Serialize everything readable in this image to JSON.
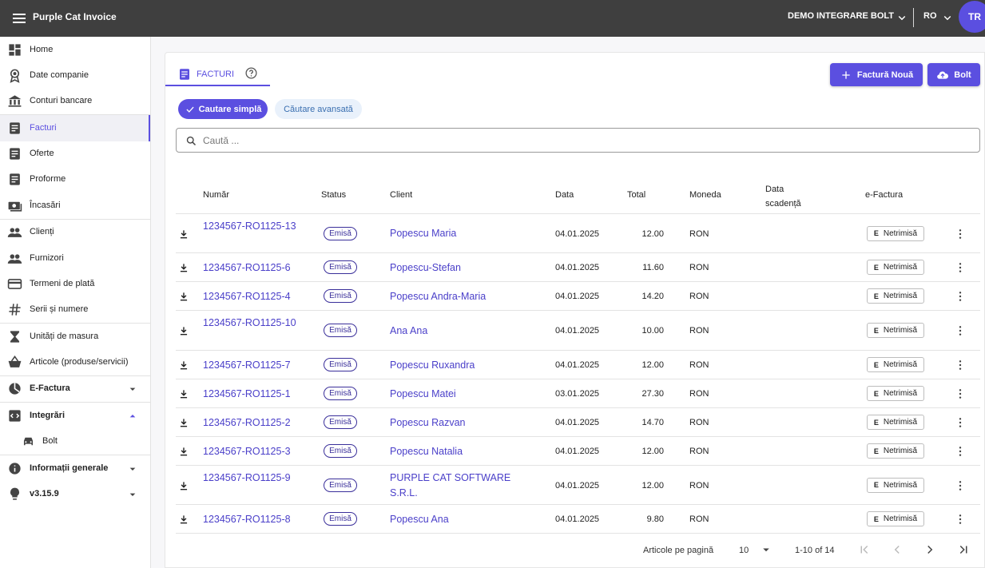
{
  "app": {
    "title": "Purple Cat Invoice",
    "account": "DEMO INTEGRARE BOLT",
    "language": "RO",
    "avatar_initials": "TR",
    "accent_color": "#5b4fe0",
    "topbar_color": "#3f3f3f"
  },
  "sidebar": {
    "items": [
      {
        "label": "Home",
        "icon": "dashboard-icon"
      },
      {
        "label": "Date companie",
        "icon": "badge-icon"
      },
      {
        "label": "Conturi bancare",
        "icon": "bank-icon"
      },
      {
        "label": "Facturi",
        "icon": "document-icon",
        "active": true
      },
      {
        "label": "Oferte",
        "icon": "document-icon"
      },
      {
        "label": "Proforme",
        "icon": "document-icon"
      },
      {
        "label": "Încasări",
        "icon": "payments-icon"
      },
      {
        "label": "Clienți",
        "icon": "people-icon"
      },
      {
        "label": "Furnizori",
        "icon": "people-icon"
      },
      {
        "label": "Termeni de plată",
        "icon": "credit-card-icon"
      },
      {
        "label": "Serii și numere",
        "icon": "hash-icon"
      },
      {
        "label": "Unități de masura",
        "icon": "hourglass-icon"
      },
      {
        "label": "Articole (produse/servicii)",
        "icon": "basket-icon"
      },
      {
        "label": "E-Factura",
        "icon": "pie-chart-icon"
      },
      {
        "label": "Integrări",
        "icon": "integration-icon"
      },
      {
        "label": "Bolt",
        "icon": "car-icon"
      },
      {
        "label": "Informații generale",
        "icon": "info-icon"
      },
      {
        "label": "v3.15.9",
        "icon": "lightbulb-icon"
      }
    ]
  },
  "main": {
    "tab_label": "FACTURI",
    "new_invoice_label": "Factură Nouă",
    "bolt_label": "Bolt",
    "chip_simple": "Cautare simplă",
    "chip_advanced": "Căutare avansată",
    "search_placeholder": "Caută ...",
    "columns": {
      "number": "Număr",
      "status": "Status",
      "client": "Client",
      "date": "Data",
      "total": "Total",
      "currency": "Moneda",
      "due_date": "Data scadență",
      "efactura": "e-Factura"
    },
    "rows": [
      {
        "number": "1234567-RO1125-13",
        "status": "Emisă",
        "client": "Popescu Maria",
        "date": "04.01.2025",
        "total": "12.00",
        "currency": "RON",
        "efactura_badge": "E",
        "efactura": "Netrimisă"
      },
      {
        "number": "1234567-RO1125-6",
        "status": "Emisă",
        "client": "Popescu-Stefan",
        "date": "04.01.2025",
        "total": "11.60",
        "currency": "RON",
        "efactura_badge": "E",
        "efactura": "Netrimisă"
      },
      {
        "number": "1234567-RO1125-4",
        "status": "Emisă",
        "client": "Popescu Andra-Maria",
        "date": "04.01.2025",
        "total": "14.20",
        "currency": "RON",
        "efactura_badge": "E",
        "efactura": "Netrimisă"
      },
      {
        "number": "1234567-RO1125-10",
        "status": "Emisă",
        "client": "Ana Ana",
        "date": "04.01.2025",
        "total": "10.00",
        "currency": "RON",
        "efactura_badge": "E",
        "efactura": "Netrimisă"
      },
      {
        "number": "1234567-RO1125-7",
        "status": "Emisă",
        "client": "Popescu Ruxandra",
        "date": "04.01.2025",
        "total": "12.00",
        "currency": "RON",
        "efactura_badge": "E",
        "efactura": "Netrimisă"
      },
      {
        "number": "1234567-RO1125-1",
        "status": "Emisă",
        "client": "Popescu Matei",
        "date": "03.01.2025",
        "total": "27.30",
        "currency": "RON",
        "efactura_badge": "E",
        "efactura": "Netrimisă"
      },
      {
        "number": "1234567-RO1125-2",
        "status": "Emisă",
        "client": "Popescu Razvan",
        "date": "04.01.2025",
        "total": "14.70",
        "currency": "RON",
        "efactura_badge": "E",
        "efactura": "Netrimisă"
      },
      {
        "number": "1234567-RO1125-3",
        "status": "Emisă",
        "client": "Popescu Natalia",
        "date": "04.01.2025",
        "total": "12.00",
        "currency": "RON",
        "efactura_badge": "E",
        "efactura": "Netrimisă"
      },
      {
        "number": "1234567-RO1125-9",
        "status": "Emisă",
        "client": "PURPLE CAT SOFTWARE S.R.L.",
        "date": "04.01.2025",
        "total": "12.00",
        "currency": "RON",
        "efactura_badge": "E",
        "efactura": "Netrimisă"
      },
      {
        "number": "1234567-RO1125-8",
        "status": "Emisă",
        "client": "Popescu Ana",
        "date": "04.01.2025",
        "total": "9.80",
        "currency": "RON",
        "efactura_badge": "E",
        "efactura": "Netrimisă"
      }
    ],
    "pagination": {
      "per_page_label": "Articole pe pagină",
      "per_page_value": "10",
      "range": "1-10 of 14"
    }
  }
}
